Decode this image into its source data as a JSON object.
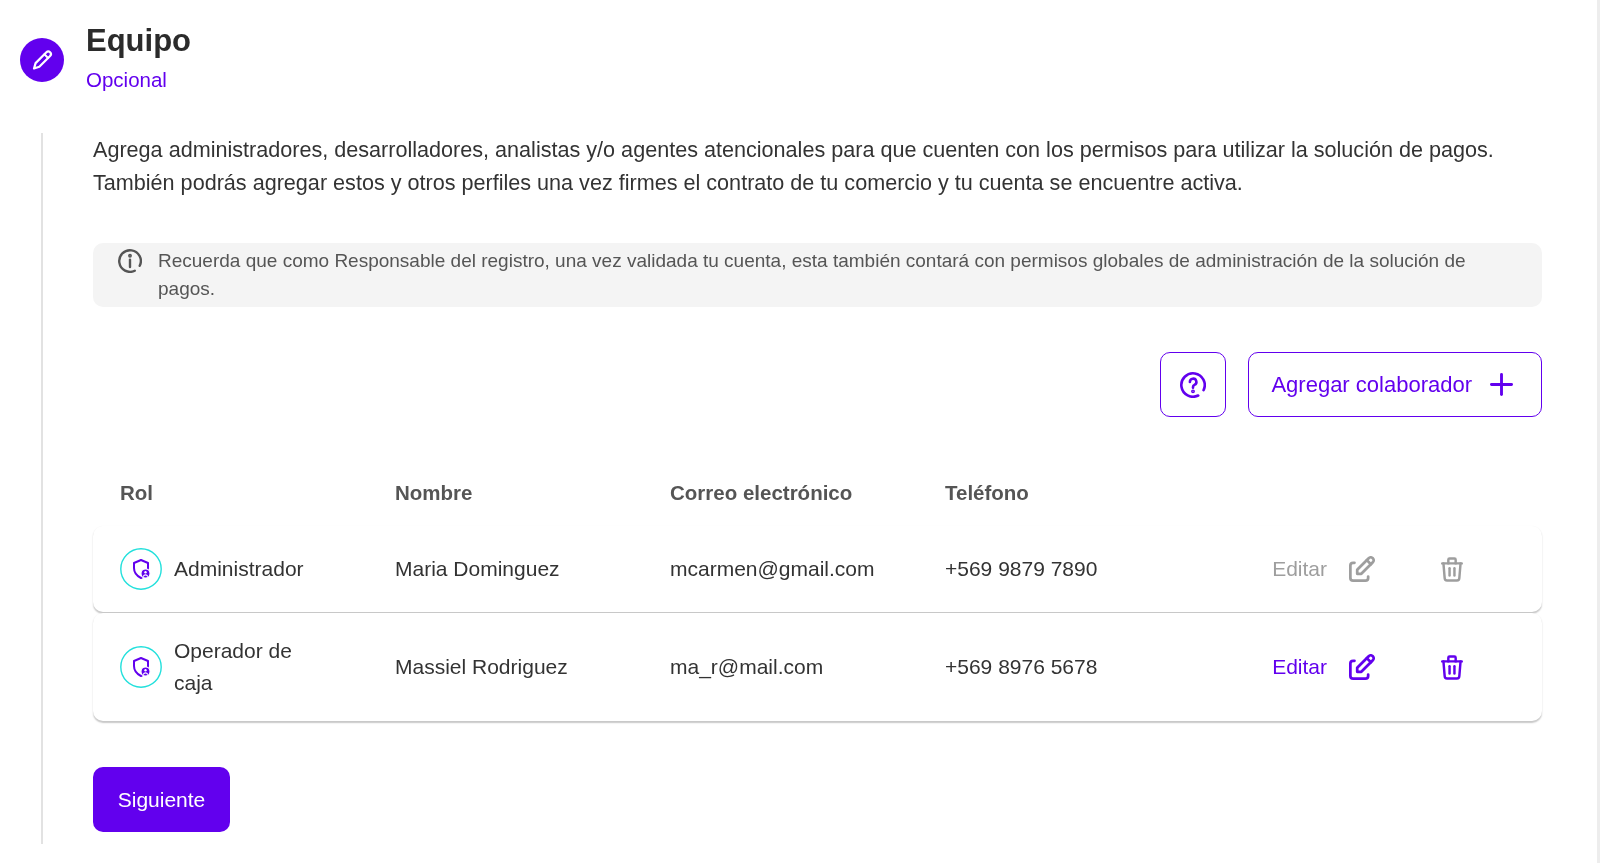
{
  "step": {
    "title": "Equipo",
    "subtitle": "Opcional"
  },
  "description": [
    "Agrega administradores, desarrolladores, analistas y/o agentes atencionales para que cuenten con los permisos para utilizar la solución de pagos.",
    "También podrás agregar estos y otros perfiles una vez firmes el contrato de tu comercio y tu cuenta se encuentre activa."
  ],
  "notice": {
    "text": "Recuerda que como Responsable del registro, una vez validada tu cuenta, esta también contará con permisos globales de administración de la solución de pagos."
  },
  "toolbar": {
    "add_button": "Agregar colaborador"
  },
  "table": {
    "columns": [
      "Rol",
      "Nombre",
      "Correo electrónico",
      "Teléfono"
    ],
    "rows": [
      {
        "role": "Administrador",
        "name": "Maria Dominguez",
        "email": "mcarmen@gmail.com",
        "phone": "+569 9879 7890",
        "edit_label": "Editar",
        "disabled": true
      },
      {
        "role": "Operador de caja",
        "name": "Massiel Rodriguez",
        "email": "ma_r@mail.com",
        "phone": "+569 8976 5678",
        "edit_label": "Editar",
        "disabled": false
      }
    ]
  },
  "next_button": "Siguiente"
}
